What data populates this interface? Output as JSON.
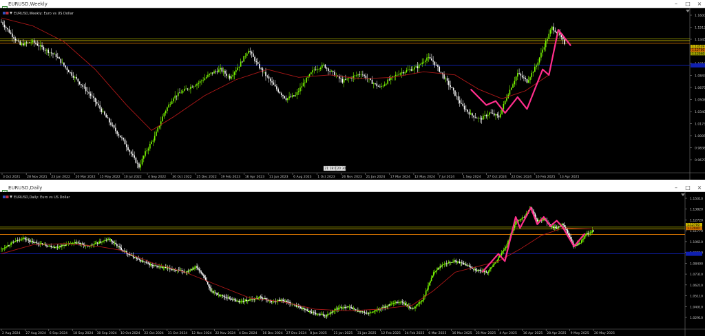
{
  "windows": [
    {
      "id": "weekly",
      "title": "EURUSD,Weekly",
      "chart_label": "EURUSD,Weekly: Euro vs US Dollar"
    },
    {
      "id": "daily",
      "title": "EURUSD,Daily",
      "chart_label": "EURUSD,Daily: Euro vs US Dollar"
    }
  ],
  "window_buttons": {
    "minimize": "–",
    "maximize": "□",
    "close": "×"
  },
  "colors": {
    "background": "#000000",
    "bull_candle": "#7CFC00",
    "bear_candle": "#FFFFFF",
    "moving_average": "#B01818",
    "zigzag": "#FF2E8C",
    "level_yellow": "#C8B400",
    "level_olive": "#9AA000",
    "level_orange": "#D07000",
    "level_blue": "#1020B0",
    "axis_text": "#C8C8C8"
  },
  "chart_data": [
    {
      "type": "candlestick",
      "timeframe": "Weekly",
      "symbol": "EURUSD",
      "description": "Euro vs US Dollar",
      "y_ticks": [
        "1.16000",
        "1.15130",
        "1.13450",
        "1.11770",
        "1.10100",
        "1.08430",
        "1.06750",
        "1.05080",
        "1.03400",
        "1.01730",
        "1.00055",
        "0.98380",
        "0.96705"
      ],
      "x_ticks": [
        "3 Oct 2021",
        "28 Nov 2021",
        "23 Jan 2022",
        "20 Mar 2022",
        "15 May 2022",
        "10 Jul 2022",
        "4 Sep 2022",
        "30 Oct 2022",
        "25 Dec 2022",
        "19 Feb 2023",
        "16 Apr 2023",
        "11 Jun 2023",
        "6 Aug 2023",
        "1 Oct 2023",
        "26 Nov 2023",
        "21 Jan 2024",
        "17 Mar 2024",
        "12 May 2024",
        "7 Jul 2024",
        "1 Sep 2024",
        "27 Oct 2024",
        "22 Dec 2024",
        "16 Feb 2025",
        "13 Apr 2025"
      ],
      "price_tags": [
        "1.13539",
        "1.12700",
        "1.12040"
      ],
      "time_badges": [
        "21:18:06",
        "20:30"
      ],
      "ylim": [
        0.96705,
        1.16
      ],
      "horizontal_levels": [
        1.1334,
        1.1312,
        1.128,
        1.1
      ],
      "close_path": [
        [
          0,
          1.155
        ],
        [
          6,
          1.14
        ],
        [
          12,
          1.126
        ],
        [
          20,
          1.13
        ],
        [
          28,
          1.12
        ],
        [
          35,
          1.112
        ],
        [
          42,
          1.095
        ],
        [
          50,
          1.078
        ],
        [
          58,
          1.06
        ],
        [
          65,
          1.04
        ],
        [
          72,
          1.02
        ],
        [
          78,
          1.005
        ],
        [
          84,
          0.985
        ],
        [
          88,
          0.972
        ],
        [
          92,
          0.99
        ],
        [
          98,
          1.01
        ],
        [
          104,
          1.04
        ],
        [
          110,
          1.06
        ],
        [
          118,
          1.07
        ],
        [
          126,
          1.078
        ],
        [
          134,
          1.09
        ],
        [
          140,
          1.095
        ],
        [
          146,
          1.085
        ],
        [
          152,
          1.1
        ],
        [
          158,
          1.12
        ],
        [
          164,
          1.1
        ],
        [
          170,
          1.085
        ],
        [
          176,
          1.07
        ],
        [
          182,
          1.058
        ],
        [
          188,
          1.062
        ],
        [
          194,
          1.08
        ],
        [
          200,
          1.095
        ],
        [
          206,
          1.1
        ],
        [
          212,
          1.09
        ],
        [
          218,
          1.08
        ],
        [
          224,
          1.085
        ],
        [
          230,
          1.09
        ],
        [
          236,
          1.08
        ],
        [
          242,
          1.072
        ],
        [
          248,
          1.082
        ],
        [
          254,
          1.09
        ],
        [
          260,
          1.094
        ],
        [
          266,
          1.098
        ],
        [
          272,
          1.11
        ],
        [
          276,
          1.105
        ],
        [
          282,
          1.088
        ],
        [
          288,
          1.07
        ],
        [
          294,
          1.05
        ],
        [
          300,
          1.038
        ],
        [
          306,
          1.032
        ],
        [
          312,
          1.04
        ],
        [
          318,
          1.035
        ],
        [
          324,
          1.065
        ],
        [
          330,
          1.09
        ],
        [
          336,
          1.08
        ],
        [
          342,
          1.1
        ],
        [
          348,
          1.13
        ],
        [
          352,
          1.148
        ],
        [
          356,
          1.14
        ],
        [
          360,
          1.128
        ]
      ],
      "ma_path": [
        [
          0,
          1.16
        ],
        [
          20,
          1.15
        ],
        [
          40,
          1.13
        ],
        [
          60,
          1.095
        ],
        [
          80,
          1.05
        ],
        [
          96,
          1.018
        ],
        [
          110,
          1.035
        ],
        [
          130,
          1.062
        ],
        [
          150,
          1.082
        ],
        [
          170,
          1.095
        ],
        [
          190,
          1.085
        ],
        [
          210,
          1.088
        ],
        [
          230,
          1.083
        ],
        [
          250,
          1.085
        ],
        [
          270,
          1.092
        ],
        [
          290,
          1.088
        ],
        [
          305,
          1.07
        ],
        [
          320,
          1.058
        ],
        [
          335,
          1.068
        ],
        [
          350,
          1.088
        ]
      ],
      "zigzag_path": [
        [
          300,
          1.07
        ],
        [
          310,
          1.05
        ],
        [
          316,
          1.055
        ],
        [
          322,
          1.04
        ],
        [
          330,
          1.06
        ],
        [
          336,
          1.045
        ],
        [
          346,
          1.095
        ],
        [
          350,
          1.088
        ],
        [
          356,
          1.145
        ],
        [
          364,
          1.125
        ]
      ]
    },
    {
      "type": "candlestick",
      "timeframe": "Daily",
      "symbol": "EURUSD",
      "description": "Euro vs US Dollar",
      "y_ticks": [
        "1.15010",
        "1.13820",
        "1.12720",
        "1.11770",
        "1.10610",
        "1.09510",
        "1.08400",
        "1.07310",
        "1.06210",
        "1.05110",
        "1.04010",
        "1.02910"
      ],
      "x_ticks": [
        "2 Aug 2024",
        "27 Aug 2024",
        "6 Sep 2024",
        "18 Sep 2024",
        "30 Sep 2024",
        "10 Oct 2024",
        "22 Oct 2024",
        "31 Oct 2024",
        "12 Nov 2024",
        "22 Nov 2024",
        "4 Dec 2024",
        "16 Dec 2024",
        "27 Dec 2024",
        "8 Jan 2025",
        "21 Jan 2025",
        "31 Jan 2025",
        "12 Feb 2025",
        "24 Feb 2025",
        "6 Mar 2025",
        "16 Mar 2025",
        "25 Mar 2025",
        "4 Apr 2025",
        "16 Apr 2025",
        "28 Apr 2025",
        "9 May 2025",
        "20 May 2025"
      ],
      "price_tags": [
        "1.12700",
        "1.12040"
      ],
      "ylim": [
        1.022,
        1.155
      ],
      "horizontal_levels": [
        1.129,
        1.127,
        1.121,
        1.1
      ],
      "close_path": [
        [
          0,
          1.105
        ],
        [
          10,
          1.112
        ],
        [
          20,
          1.117
        ],
        [
          30,
          1.112
        ],
        [
          40,
          1.11
        ],
        [
          50,
          1.107
        ],
        [
          60,
          1.11
        ],
        [
          70,
          1.112
        ],
        [
          80,
          1.108
        ],
        [
          90,
          1.112
        ],
        [
          100,
          1.116
        ],
        [
          110,
          1.106
        ],
        [
          120,
          1.098
        ],
        [
          130,
          1.092
        ],
        [
          140,
          1.087
        ],
        [
          150,
          1.085
        ],
        [
          160,
          1.083
        ],
        [
          170,
          1.08
        ],
        [
          180,
          1.086
        ],
        [
          186,
          1.078
        ],
        [
          194,
          1.06
        ],
        [
          200,
          1.056
        ],
        [
          210,
          1.052
        ],
        [
          220,
          1.048
        ],
        [
          230,
          1.05
        ],
        [
          240,
          1.053
        ],
        [
          250,
          1.048
        ],
        [
          260,
          1.05
        ],
        [
          270,
          1.045
        ],
        [
          280,
          1.04
        ],
        [
          290,
          1.035
        ],
        [
          300,
          1.033
        ],
        [
          310,
          1.04
        ],
        [
          320,
          1.043
        ],
        [
          330,
          1.038
        ],
        [
          340,
          1.035
        ],
        [
          350,
          1.04
        ],
        [
          360,
          1.045
        ],
        [
          370,
          1.048
        ],
        [
          380,
          1.04
        ],
        [
          390,
          1.05
        ],
        [
          400,
          1.08
        ],
        [
          410,
          1.09
        ],
        [
          420,
          1.092
        ],
        [
          430,
          1.088
        ],
        [
          440,
          1.082
        ],
        [
          450,
          1.08
        ],
        [
          460,
          1.095
        ],
        [
          468,
          1.11
        ],
        [
          476,
          1.135
        ],
        [
          484,
          1.14
        ],
        [
          490,
          1.15
        ],
        [
          496,
          1.135
        ],
        [
          502,
          1.138
        ],
        [
          508,
          1.13
        ],
        [
          514,
          1.128
        ],
        [
          520,
          1.132
        ],
        [
          526,
          1.118
        ],
        [
          530,
          1.108
        ],
        [
          536,
          1.112
        ],
        [
          542,
          1.122
        ],
        [
          548,
          1.125
        ]
      ],
      "ma_path": [
        [
          0,
          1.1
        ],
        [
          30,
          1.11
        ],
        [
          60,
          1.111
        ],
        [
          90,
          1.108
        ],
        [
          110,
          1.104
        ],
        [
          140,
          1.09
        ],
        [
          170,
          1.08
        ],
        [
          200,
          1.066
        ],
        [
          230,
          1.052
        ],
        [
          260,
          1.048
        ],
        [
          290,
          1.04
        ],
        [
          320,
          1.038
        ],
        [
          350,
          1.04
        ],
        [
          380,
          1.044
        ],
        [
          400,
          1.06
        ],
        [
          420,
          1.08
        ],
        [
          440,
          1.086
        ],
        [
          460,
          1.092
        ],
        [
          480,
          1.105
        ],
        [
          500,
          1.12
        ],
        [
          520,
          1.128
        ],
        [
          548,
          1.127
        ]
      ],
      "zigzag_path": [
        [
          445,
          1.08
        ],
        [
          460,
          1.1
        ],
        [
          466,
          1.092
        ],
        [
          476,
          1.14
        ],
        [
          480,
          1.128
        ],
        [
          490,
          1.15
        ],
        [
          496,
          1.132
        ],
        [
          502,
          1.14
        ],
        [
          508,
          1.13
        ],
        [
          514,
          1.136
        ],
        [
          520,
          1.128
        ],
        [
          530,
          1.108
        ],
        [
          540,
          1.122
        ]
      ]
    }
  ]
}
